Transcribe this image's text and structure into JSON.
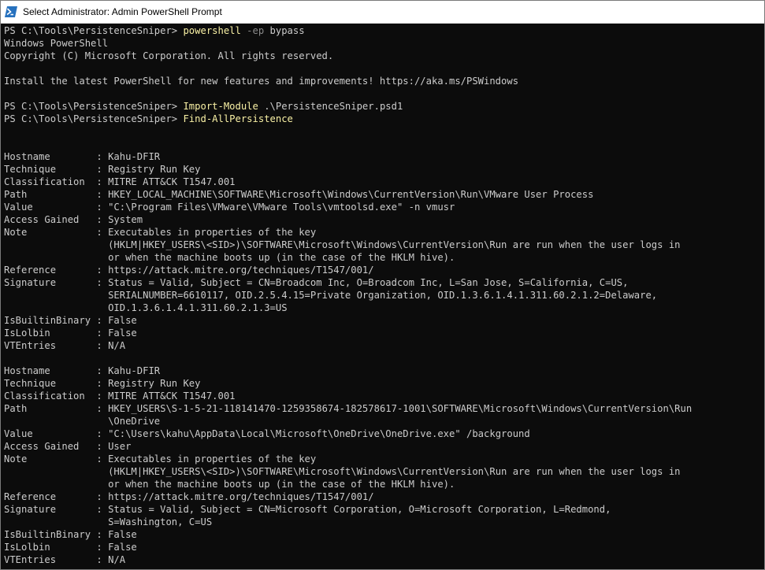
{
  "window": {
    "title": "Select Administrator: Admin PowerShell Prompt",
    "icon": "powershell-icon",
    "colors": {
      "background": "#0c0c0c",
      "text": "#cccccc",
      "command": "#f9f1a5",
      "parameter": "#8a8a8a",
      "titlebar": "#ffffff"
    }
  },
  "console": {
    "prompt": "PS C:\\Tools\\PersistenceSniper> ",
    "cmd1": {
      "command": "powershell",
      "param": " -ep",
      "arg": " bypass"
    },
    "banner1": "Windows PowerShell",
    "banner2": "Copyright (C) Microsoft Corporation. All rights reserved.",
    "banner3": "Install the latest PowerShell for new features and improvements! https://aka.ms/PSWindows",
    "cmd2": {
      "command": "Import-Module",
      "arg": " .\\PersistenceSniper.psd1"
    },
    "cmd3": {
      "command": "Find-AllPersistence"
    },
    "labels": {
      "hostname": "Hostname        : ",
      "technique": "Technique       : ",
      "classification": "Classification  : ",
      "path": "Path            : ",
      "value": "Value           : ",
      "access": "Access Gained   : ",
      "note": "Note            : ",
      "reference": "Reference       : ",
      "signature": "Signature       : ",
      "builtin": "IsBuiltinBinary : ",
      "lolbin": "IsLolbin        : ",
      "vt": "VTEntries       : "
    },
    "indent": "                  ",
    "records": [
      {
        "hostname": "Kahu-DFIR",
        "technique": "Registry Run Key",
        "classification": "MITRE ATT&CK T1547.001",
        "path": [
          "HKEY_LOCAL_MACHINE\\SOFTWARE\\Microsoft\\Windows\\CurrentVersion\\Run\\VMware User Process"
        ],
        "value": "\"C:\\Program Files\\VMware\\VMware Tools\\vmtoolsd.exe\" -n vmusr",
        "access": "System",
        "note": [
          "Executables in properties of the key",
          "(HKLM|HKEY_USERS\\<SID>)\\SOFTWARE\\Microsoft\\Windows\\CurrentVersion\\Run are run when the user logs in",
          "or when the machine boots up (in the case of the HKLM hive)."
        ],
        "reference": "https://attack.mitre.org/techniques/T1547/001/",
        "signature": [
          "Status = Valid, Subject = CN=Broadcom Inc, O=Broadcom Inc, L=San Jose, S=California, C=US,",
          "SERIALNUMBER=6610117, OID.2.5.4.15=Private Organization, OID.1.3.6.1.4.1.311.60.2.1.2=Delaware,",
          "OID.1.3.6.1.4.1.311.60.2.1.3=US"
        ],
        "builtin": "False",
        "lolbin": "False",
        "vt": "N/A"
      },
      {
        "hostname": "Kahu-DFIR",
        "technique": "Registry Run Key",
        "classification": "MITRE ATT&CK T1547.001",
        "path": [
          "HKEY_USERS\\S-1-5-21-118141470-1259358674-182578617-1001\\SOFTWARE\\Microsoft\\Windows\\CurrentVersion\\Run",
          "\\OneDrive"
        ],
        "value": "\"C:\\Users\\kahu\\AppData\\Local\\Microsoft\\OneDrive\\OneDrive.exe\" /background",
        "access": "User",
        "note": [
          "Executables in properties of the key",
          "(HKLM|HKEY_USERS\\<SID>)\\SOFTWARE\\Microsoft\\Windows\\CurrentVersion\\Run are run when the user logs in",
          "or when the machine boots up (in the case of the HKLM hive)."
        ],
        "reference": "https://attack.mitre.org/techniques/T1547/001/",
        "signature": [
          "Status = Valid, Subject = CN=Microsoft Corporation, O=Microsoft Corporation, L=Redmond,",
          "S=Washington, C=US"
        ],
        "builtin": "False",
        "lolbin": "False",
        "vt": "N/A"
      }
    ]
  }
}
